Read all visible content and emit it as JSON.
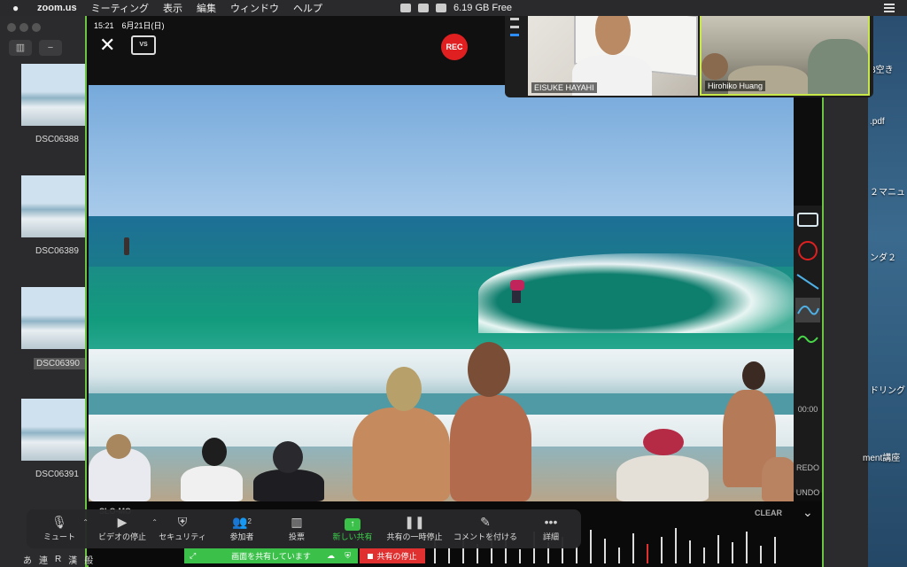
{
  "menubar": {
    "app": "zoom.us",
    "items": [
      "ミーティング",
      "表示",
      "編集",
      "ウィンドウ",
      "ヘルプ"
    ],
    "memory": "6.19 GB Free"
  },
  "finder": {
    "files": [
      "DSC06388",
      "DSC06389",
      "DSC06390",
      "DSC06391"
    ]
  },
  "desktop": {
    "labels": [
      "B空き",
      ".pdf",
      "２マニュ",
      "ンダ２",
      "ドリング",
      "ment講座"
    ]
  },
  "share": {
    "clock": "15:21　6月21日(日)",
    "vs_label": "VS",
    "rec_label": "REC",
    "slo_mo": "SLO-MO",
    "clear": "CLEAR",
    "time": "00:00",
    "redo": "REDO",
    "undo": "UNDO"
  },
  "controls": [
    {
      "label": "ミュート",
      "icon": "microphone-icon"
    },
    {
      "label": "ビデオの停止",
      "icon": "video-camera-icon"
    },
    {
      "label": "セキュリティ",
      "icon": "shield-icon"
    },
    {
      "label": "参加者",
      "icon": "participants-icon",
      "count": "2"
    },
    {
      "label": "投票",
      "icon": "poll-icon"
    },
    {
      "label": "新しい共有",
      "icon": "share-arrow-icon"
    },
    {
      "label": "共有の一時停止",
      "icon": "pause-icon"
    },
    {
      "label": "コメントを付ける",
      "icon": "pencil-icon"
    },
    {
      "label": "詳細",
      "icon": "more-icon"
    }
  ],
  "sharebar": {
    "status": "画面を共有しています",
    "stop": "共有の停止"
  },
  "ime": {
    "items": [
      "あ",
      "連",
      "R",
      "漢",
      "般"
    ]
  },
  "videos": [
    {
      "name": "EISUKE HAYAHI"
    },
    {
      "name": "Hirohiko Huang"
    }
  ],
  "colors": {
    "share_border": "#6dc443",
    "rec": "#e02020",
    "share_green": "#3bc04a",
    "stop_red": "#e03030"
  }
}
